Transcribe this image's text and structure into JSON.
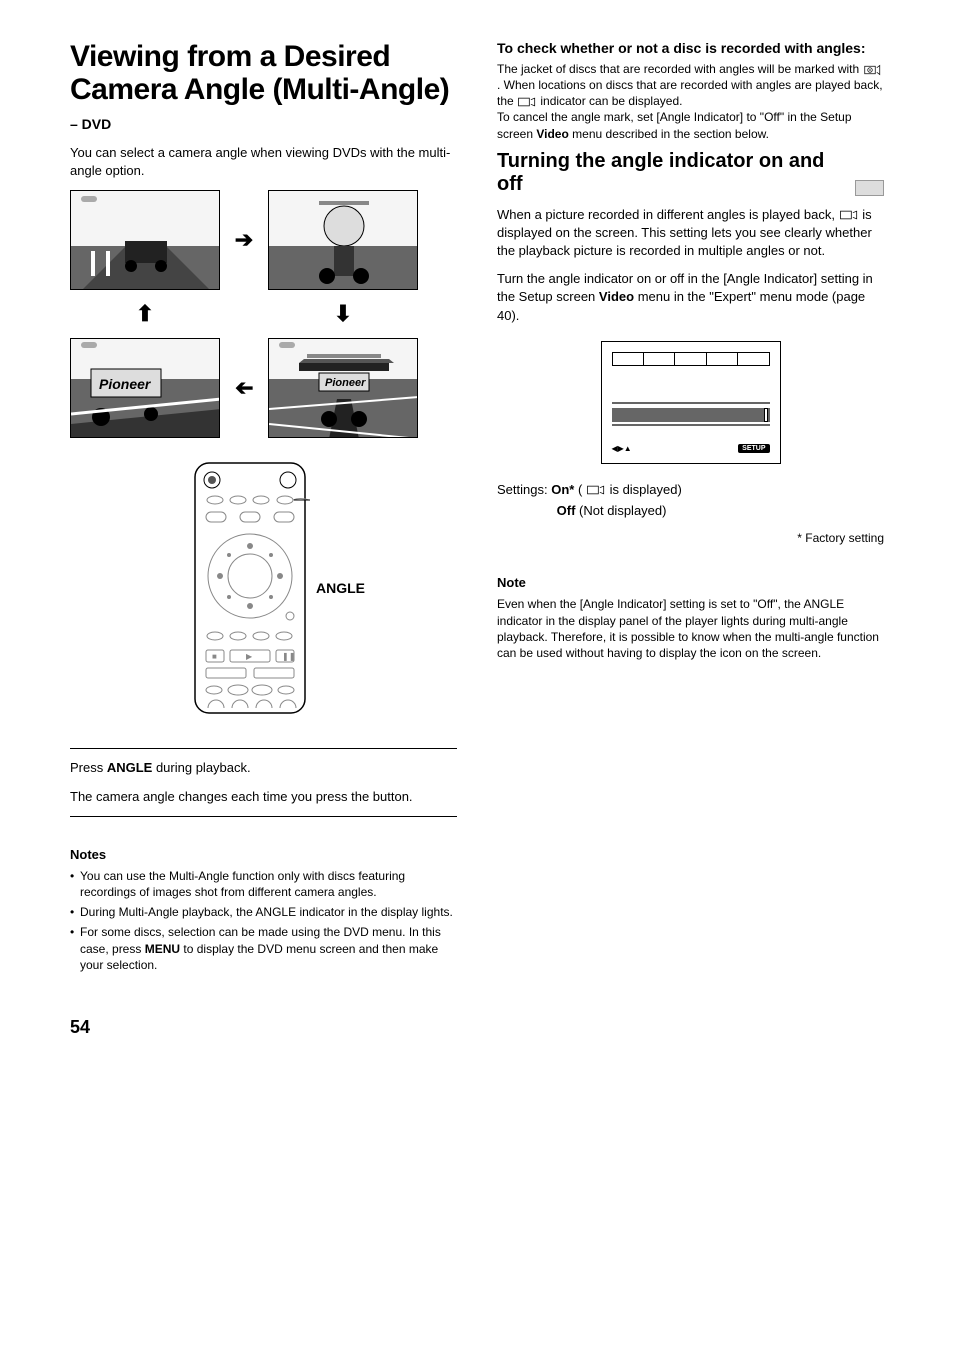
{
  "left": {
    "title": "Viewing from a Desired Camera Angle (Multi-Angle)",
    "dvd_label": "– DVD",
    "intro": "You can select a camera angle when viewing DVDs with the multi-angle option.",
    "remote_label": "ANGLE",
    "press_line_pre": "Press ",
    "press_line_bold": "ANGLE",
    "press_line_post": " during playback.",
    "result_line": "The camera angle changes each time you press the button.",
    "notes_heading": "Notes",
    "notes": [
      "You can use the Multi-Angle function only with discs featuring recordings of images shot from different camera angles.",
      "During Multi-Angle playback, the ANGLE indicator in the display lights.",
      "For some discs, selection can be made using the DVD menu. In this case, press MENU to display the DVD menu screen and then make your selection."
    ],
    "menu_bold": "MENU"
  },
  "right": {
    "check_heading": "To check whether or not a disc is recorded with angles:",
    "check_body_1": "The jacket of discs that are recorded with angles will be marked with ",
    "check_body_2": ". When locations on discs that are recorded with angles are played back, the ",
    "check_body_3": " indicator can be displayed.",
    "check_body_4": "To cancel the angle mark, set [Angle Indicator] to \"Off\" in the Setup screen ",
    "check_body_5_bold": "Video",
    "check_body_6": " menu described in the section below.",
    "h2": "Turning the angle indicator on and off",
    "para1": "When a picture recorded in different angles is played back, ",
    "para1b": " is displayed on the screen. This setting lets you see clearly whether the playback picture is recorded in multiple angles or not.",
    "para2_pre": "Turn the angle indicator on or off in the [Angle Indicator] setting in the Setup screen ",
    "para2_bold": "Video",
    "para2_post": " menu in the \"Expert\" menu mode (page 40).",
    "setup_label": "SETUP",
    "settings_label": "Settings:",
    "settings_on": "On*",
    "settings_on_desc": " is displayed)",
    "settings_off": "Off",
    "settings_off_desc": " (Not displayed)",
    "factory": "* Factory setting",
    "note_heading": "Note",
    "note_body": "Even when the [Angle Indicator] setting is set to \"Off\", the ANGLE indicator in the display panel of the player lights during multi-angle playback. Therefore, it is possible to know when the multi-angle function can be used without having to display the icon on the screen."
  },
  "page_number": "54"
}
